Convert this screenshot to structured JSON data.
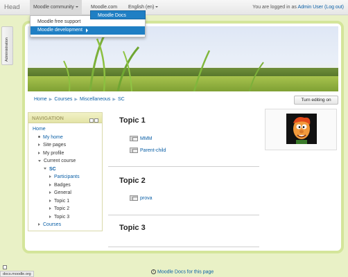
{
  "navbar": {
    "brand": "Head",
    "menus": [
      {
        "label": "Moodle community",
        "has_caret": true
      },
      {
        "label": "Moodle.com",
        "has_caret": false
      },
      {
        "label": "English (en)",
        "has_caret": true
      }
    ],
    "login_prefix": "You are logged in as",
    "user": "Admin User",
    "logout": "(Log out)"
  },
  "dropdown": {
    "items": [
      "Moodle free support",
      "Moodle development"
    ],
    "submenu_item": "Moodle Docs"
  },
  "admin_tab": "Administration",
  "breadcrumb": [
    "Home",
    "Courses",
    "Miscellaneous",
    "SC"
  ],
  "edit_button": "Turn editing on",
  "navigation": {
    "title": "NAVIGATION",
    "items": [
      {
        "label": "Home",
        "style": "link",
        "indent": 0,
        "marker": "none"
      },
      {
        "label": "My home",
        "style": "link",
        "indent": 1,
        "marker": "dot"
      },
      {
        "label": "Site pages",
        "style": "plain",
        "indent": 1,
        "marker": "right"
      },
      {
        "label": "My profile",
        "style": "plain",
        "indent": 1,
        "marker": "right"
      },
      {
        "label": "Current course",
        "style": "plain",
        "indent": 1,
        "marker": "down"
      },
      {
        "label": "SC",
        "style": "bold",
        "indent": 2,
        "marker": "down"
      },
      {
        "label": "Participants",
        "style": "link",
        "indent": 3,
        "marker": "right"
      },
      {
        "label": "Badges",
        "style": "plain",
        "indent": 3,
        "marker": "right"
      },
      {
        "label": "General",
        "style": "plain",
        "indent": 3,
        "marker": "right"
      },
      {
        "label": "Topic 1",
        "style": "plain",
        "indent": 3,
        "marker": "right"
      },
      {
        "label": "Topic 2",
        "style": "plain",
        "indent": 3,
        "marker": "right"
      },
      {
        "label": "Topic 3",
        "style": "plain",
        "indent": 3,
        "marker": "right"
      },
      {
        "label": "Courses",
        "style": "link",
        "indent": 1,
        "marker": "right"
      }
    ]
  },
  "topics": [
    {
      "title": "Topic 1",
      "activities": [
        "MMM",
        "Parent-child"
      ]
    },
    {
      "title": "Topic 2",
      "activities": [
        "prova"
      ]
    },
    {
      "title": "Topic 3",
      "activities": []
    }
  ],
  "footer": {
    "docs_link": "Moodle Docs for this page",
    "status_url": "docs.moodle.org"
  }
}
